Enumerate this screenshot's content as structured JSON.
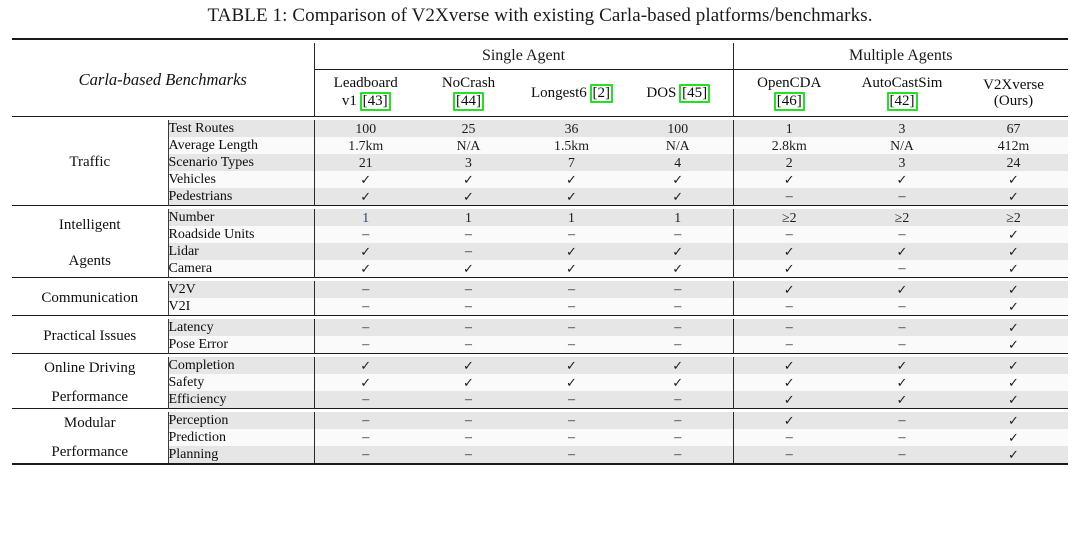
{
  "caption": "TABLE 1: Comparison of V2Xverse with existing Carla-based platforms/benchmarks.",
  "header": {
    "row_label_title": "Carla-based Benchmarks",
    "groups": [
      {
        "label": "Single Agent",
        "span": 4
      },
      {
        "label": "Multiple Agents",
        "span": 3
      }
    ],
    "columns": [
      {
        "name": "Leadboard",
        "name2": "v1",
        "cite": "[43]",
        "cite_highlight": true,
        "cite_on_line": 2
      },
      {
        "name": "NoCrash",
        "name2": "",
        "cite": "[44]",
        "cite_highlight": true,
        "cite_on_line": 2
      },
      {
        "name": "Longest6",
        "name2": "",
        "cite": "[2]",
        "cite_highlight": true,
        "cite_on_line": 1
      },
      {
        "name": "DOS",
        "name2": "",
        "cite": "[45]",
        "cite_highlight": true,
        "cite_on_line": 1
      },
      {
        "name": "OpenCDA",
        "name2": "",
        "cite": "[46]",
        "cite_highlight": true,
        "cite_on_line": 2
      },
      {
        "name": "AutoCastSim",
        "name2": "",
        "cite": "[42]",
        "cite_highlight": true,
        "cite_on_line": 2
      },
      {
        "name": "V2Xverse",
        "name2": "(Ours)",
        "cite": "",
        "cite_highlight": false,
        "cite_on_line": 0
      }
    ]
  },
  "colors": {
    "highlight_green": "#22e022",
    "shade_row": "#e6e6e6",
    "plain_row": "#fafafa",
    "rule": "#1a1a1a",
    "accent_value": "#1b4a6b"
  },
  "sections": [
    {
      "label": "Traffic",
      "label_line2": "",
      "rows": [
        {
          "name": "Test Routes",
          "values": [
            "100",
            "25",
            "36",
            "100",
            "1",
            "3",
            "67"
          ]
        },
        {
          "name": "Average Length",
          "values": [
            "1.7km",
            "N/A",
            "1.5km",
            "N/A",
            "2.8km",
            "N/A",
            "412m"
          ]
        },
        {
          "name": "Scenario Types",
          "values": [
            "21",
            "3",
            "7",
            "4",
            "2",
            "3",
            "24"
          ]
        },
        {
          "name": "Vehicles",
          "values": [
            "✓",
            "✓",
            "✓",
            "✓",
            "✓",
            "✓",
            "✓"
          ]
        },
        {
          "name": "Pedestrians",
          "values": [
            "✓",
            "✓",
            "✓",
            "✓",
            "–",
            "–",
            "✓"
          ]
        }
      ]
    },
    {
      "label": "Intelligent",
      "label_line2": "Agents",
      "rows": [
        {
          "name": "Number",
          "values": [
            "1",
            "1",
            "1",
            "1",
            "≥2",
            "≥2",
            "≥2"
          ],
          "accent_index": 0
        },
        {
          "name": "Roadside Units",
          "values": [
            "–",
            "–",
            "–",
            "–",
            "–",
            "–",
            "✓"
          ]
        },
        {
          "name": "Lidar",
          "values": [
            "✓",
            "–",
            "✓",
            "✓",
            "✓",
            "✓",
            "✓"
          ]
        },
        {
          "name": "Camera",
          "values": [
            "✓",
            "✓",
            "✓",
            "✓",
            "✓",
            "–",
            "✓"
          ]
        }
      ]
    },
    {
      "label": "Communication",
      "label_line2": "",
      "rows": [
        {
          "name": "V2V",
          "values": [
            "–",
            "–",
            "–",
            "–",
            "✓",
            "✓",
            "✓"
          ]
        },
        {
          "name": "V2I",
          "values": [
            "–",
            "–",
            "–",
            "–",
            "–",
            "–",
            "✓"
          ]
        }
      ]
    },
    {
      "label": "Practical Issues",
      "label_line2": "",
      "rows": [
        {
          "name": "Latency",
          "values": [
            "–",
            "–",
            "–",
            "–",
            "–",
            "–",
            "✓"
          ]
        },
        {
          "name": "Pose Error",
          "values": [
            "–",
            "–",
            "–",
            "–",
            "–",
            "–",
            "✓"
          ]
        }
      ]
    },
    {
      "label": "Online Driving",
      "label_line2": "Performance",
      "rows": [
        {
          "name": "Completion",
          "values": [
            "✓",
            "✓",
            "✓",
            "✓",
            "✓",
            "✓",
            "✓"
          ]
        },
        {
          "name": "Safety",
          "values": [
            "✓",
            "✓",
            "✓",
            "✓",
            "✓",
            "✓",
            "✓"
          ]
        },
        {
          "name": "Efficiency",
          "values": [
            "–",
            "–",
            "–",
            "–",
            "✓",
            "✓",
            "✓"
          ]
        }
      ]
    },
    {
      "label": "Modular",
      "label_line2": "Performance",
      "rows": [
        {
          "name": "Perception",
          "values": [
            "–",
            "–",
            "–",
            "–",
            "✓",
            "–",
            "✓"
          ]
        },
        {
          "name": "Prediction",
          "values": [
            "–",
            "–",
            "–",
            "–",
            "–",
            "–",
            "✓"
          ]
        },
        {
          "name": "Planning",
          "values": [
            "–",
            "–",
            "–",
            "–",
            "–",
            "–",
            "✓"
          ]
        }
      ]
    }
  ]
}
